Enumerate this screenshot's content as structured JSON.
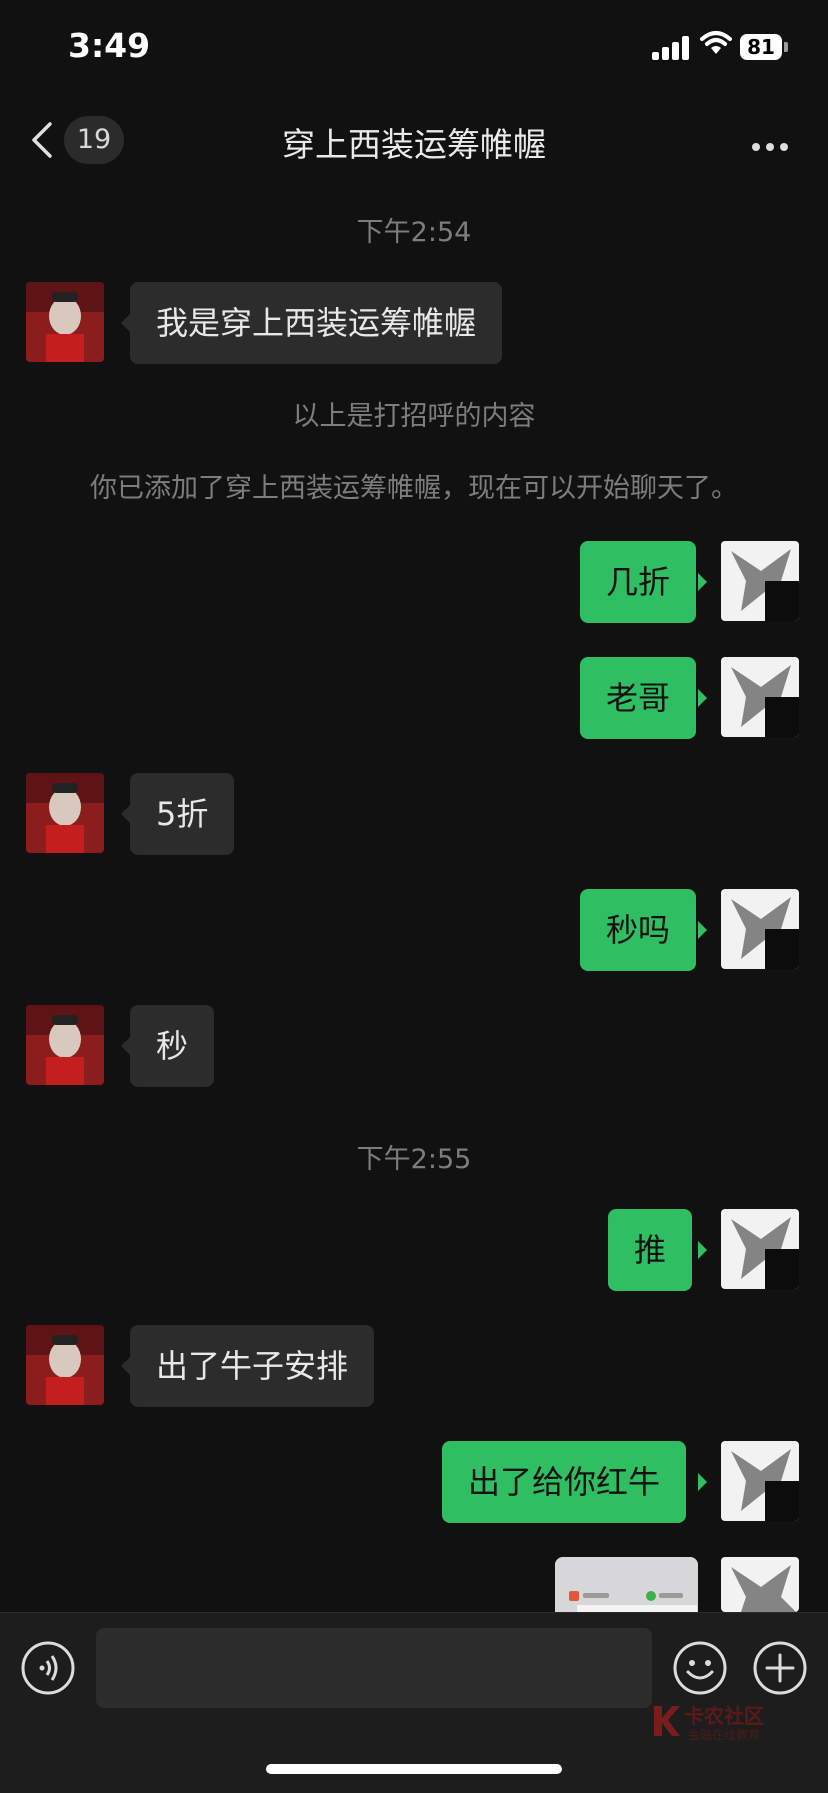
{
  "status_bar": {
    "time": "3:49",
    "battery": "81"
  },
  "nav": {
    "unread_count": "19",
    "title": "穿上西装运筹帷幄"
  },
  "messages": [
    {
      "type": "time",
      "text": "下午2:54"
    },
    {
      "type": "incoming",
      "text": "我是穿上西装运筹帷幄"
    },
    {
      "type": "system",
      "text": "以上是打招呼的内容"
    },
    {
      "type": "system",
      "text": "你已添加了穿上西装运筹帷幄，现在可以开始聊天了。"
    },
    {
      "type": "outgoing",
      "text": "几折"
    },
    {
      "type": "outgoing",
      "text": "老哥"
    },
    {
      "type": "incoming",
      "text": "5折"
    },
    {
      "type": "outgoing",
      "text": "秒吗"
    },
    {
      "type": "incoming",
      "text": "秒"
    },
    {
      "type": "time",
      "text": "下午2:55"
    },
    {
      "type": "outgoing",
      "text": "推"
    },
    {
      "type": "incoming",
      "text": "出了牛子安排"
    },
    {
      "type": "outgoing",
      "text": "出了给你红牛"
    },
    {
      "type": "outgoing_image",
      "text": ""
    }
  ],
  "watermark": {
    "title": "卡农社区",
    "subtitle": "金融在线教育"
  },
  "colors": {
    "background": "#111111",
    "incoming_bubble": "#2c2c2c",
    "outgoing_bubble": "#2fbe62",
    "system_text": "#7d7d7d"
  },
  "icons": [
    "back-icon",
    "more-icon",
    "voice-icon",
    "emoji-icon",
    "plus-icon",
    "signal-icon",
    "wifi-icon",
    "battery-icon"
  ]
}
